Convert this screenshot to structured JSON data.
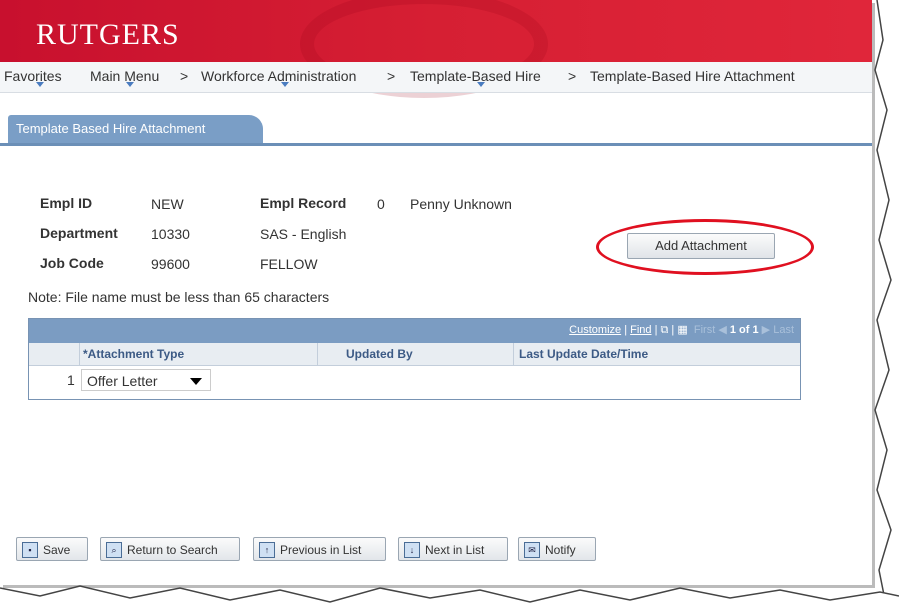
{
  "banner": {
    "logo": "RUTGERS"
  },
  "nav": {
    "items": [
      "Favorites",
      "Main Menu",
      ">",
      "Workforce Administration",
      ">",
      "Template-Based Hire",
      ">",
      "Template-Based Hire Attachment"
    ]
  },
  "tab": {
    "label": "Template Based Hire Attachment"
  },
  "fields": {
    "empl_id_label": "Empl ID",
    "empl_id_value": "NEW",
    "empl_record_label": "Empl Record",
    "empl_record_value": "0",
    "employee_name": "Penny Unknown",
    "department_label": "Department",
    "department_value": "10330",
    "department_name": "SAS - English",
    "job_code_label": "Job Code",
    "job_code_value": "99600",
    "job_code_name": "FELLOW"
  },
  "add_attachment": {
    "label": "Add Attachment"
  },
  "note": "Note: File name must be less than 65 characters",
  "grid": {
    "controls": {
      "customize": "Customize",
      "find": "Find",
      "first": "First",
      "pager": "1 of 1",
      "last": "Last"
    },
    "columns": [
      "*Attachment Type",
      "Updated By",
      "Last Update Date/Time"
    ],
    "rows": [
      {
        "num": "1",
        "type": "Offer Letter",
        "updated_by": "",
        "updated_at": ""
      }
    ]
  },
  "toolbar": {
    "save": "Save",
    "return": "Return to Search",
    "previous": "Previous in List",
    "next": "Next in List",
    "notify": "Notify"
  },
  "colors": {
    "brand_red": "#c8102e",
    "tab_blue": "#7a9ec6",
    "highlight_red": "#e01020"
  }
}
